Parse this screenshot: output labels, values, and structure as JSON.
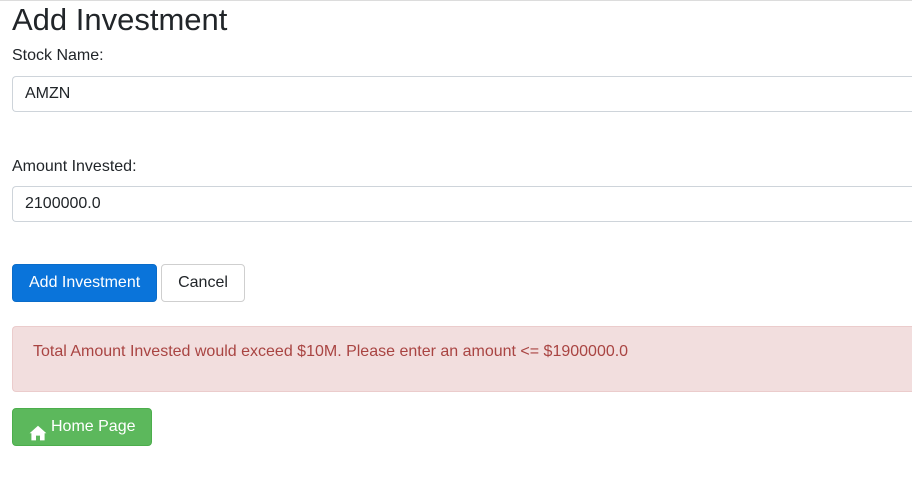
{
  "page": {
    "title": "Add Investment"
  },
  "form": {
    "stock_name_label": "Stock Name:",
    "stock_name_value": "AMZN",
    "amount_label": "Amount Invested:",
    "amount_value": "2100000.0"
  },
  "actions": {
    "add_label": "Add Investment",
    "cancel_label": "Cancel",
    "home_label": "Home Page",
    "home_icon": "home-icon"
  },
  "alert": {
    "message": "Total Amount Invested would exceed $10M. Please enter an amount <= $1900000.0"
  },
  "colors": {
    "primary": "#0a74da",
    "success": "#5cb85c",
    "danger_text": "#a94442",
    "danger_bg": "#f2dede"
  }
}
